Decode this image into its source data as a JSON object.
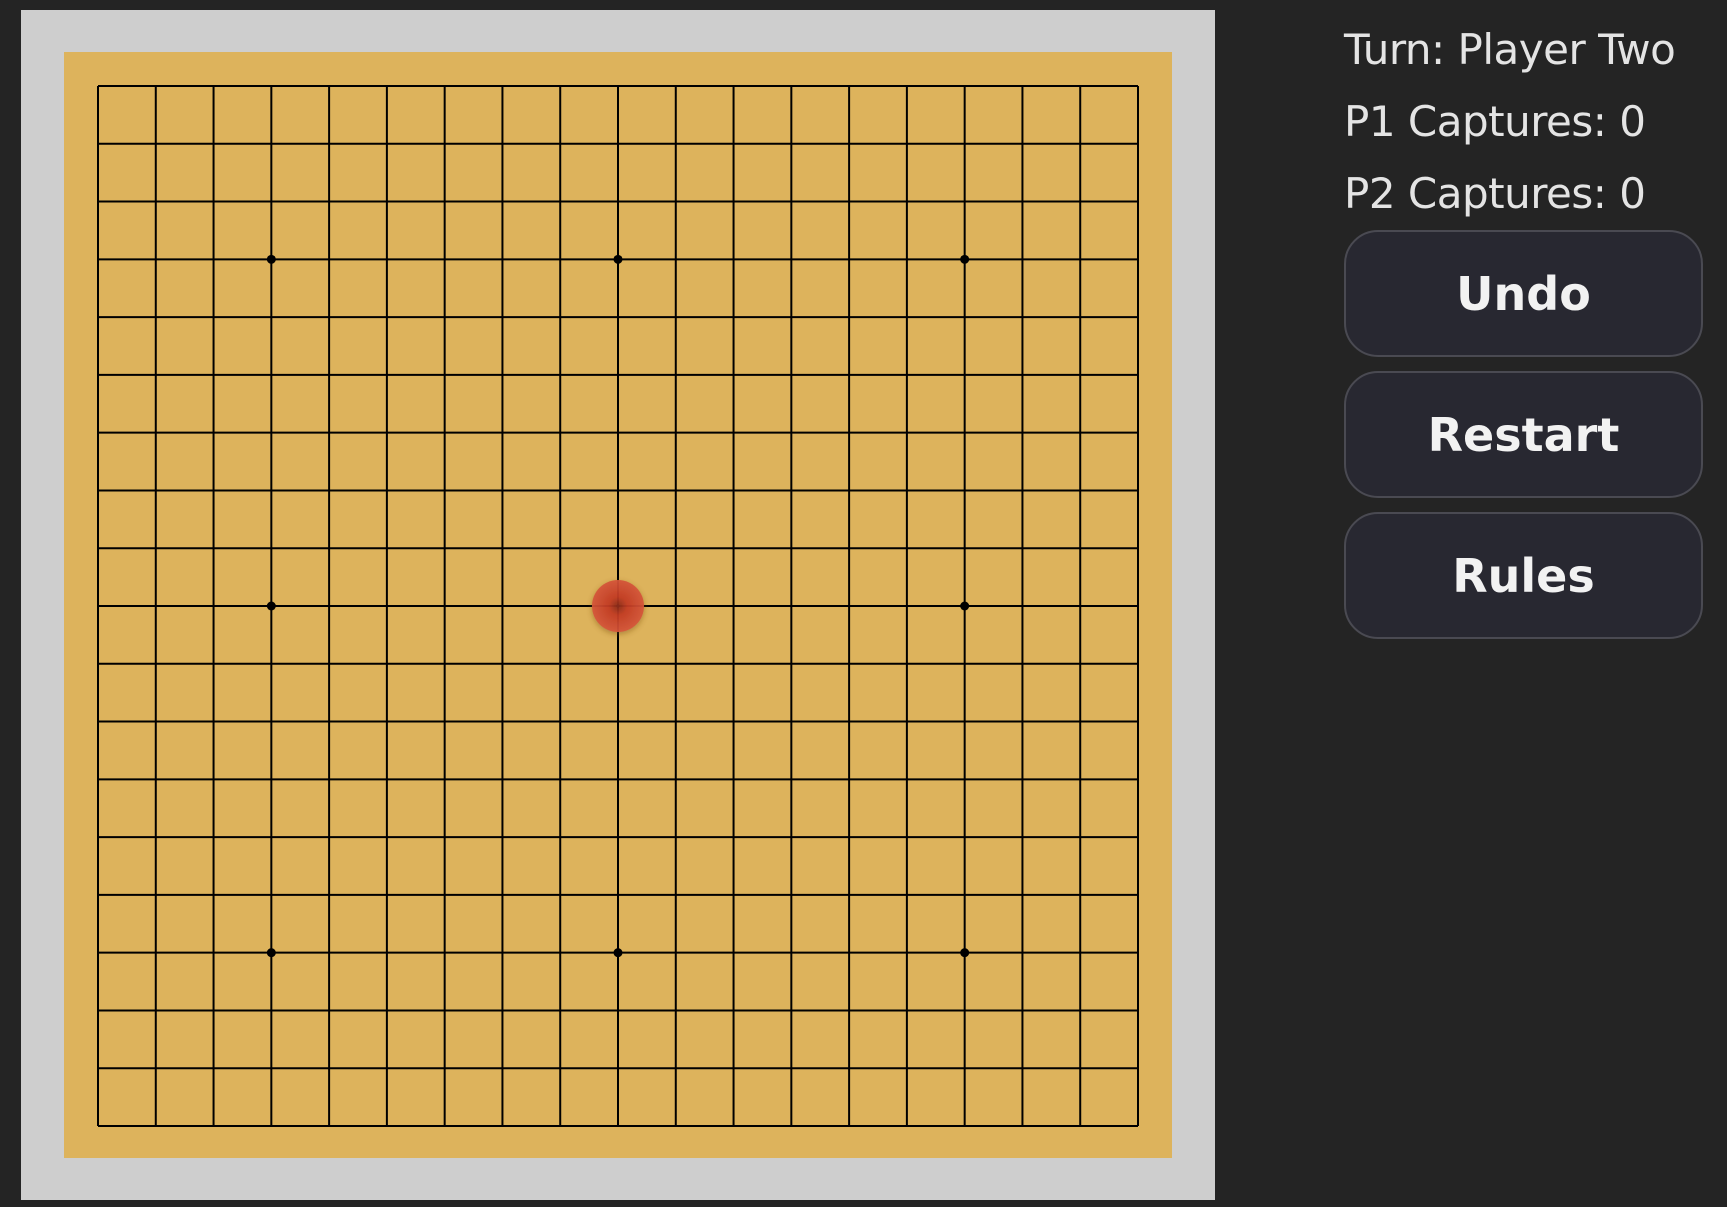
{
  "game": {
    "board_size": 19,
    "star_points": [
      [
        3,
        3
      ],
      [
        3,
        9
      ],
      [
        3,
        15
      ],
      [
        9,
        3
      ],
      [
        9,
        15
      ],
      [
        15,
        3
      ],
      [
        15,
        9
      ],
      [
        15,
        15
      ]
    ],
    "stones": [
      {
        "row": 9,
        "col": 9,
        "player": "one",
        "color": "#c8402a"
      }
    ]
  },
  "status": {
    "turn": "Turn: Player Two",
    "p1_captures": "P1 Captures: 0",
    "p2_captures": "P2 Captures: 0"
  },
  "controls": {
    "undo_label": "Undo",
    "restart_label": "Restart",
    "rules_label": "Rules"
  },
  "colors": {
    "page_background": "#242424",
    "board_frame": "#cecece",
    "board_wood": "#ddb35c",
    "grid_line": "#000000",
    "button_background": "#282831",
    "button_border": "#4a4a52",
    "text": "#e4e4e4"
  },
  "icons": {
    "stone": "red-stone"
  }
}
